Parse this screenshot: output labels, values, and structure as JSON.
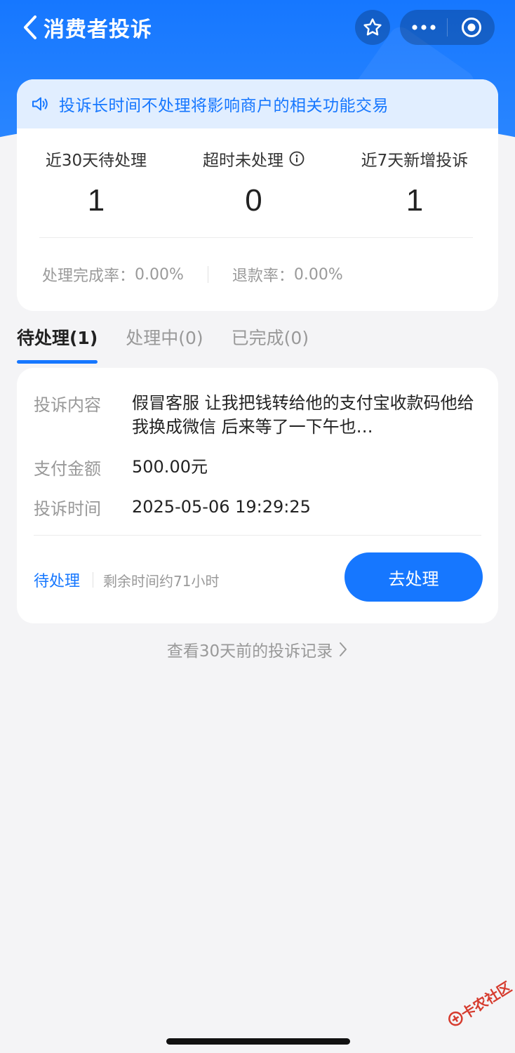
{
  "nav": {
    "title": "消费者投诉",
    "icons": {
      "back": "chevron-left-icon",
      "favorite": "star-icon",
      "more": "more-dots-icon",
      "close": "target-close-icon"
    }
  },
  "notice": {
    "icon": "speaker-icon",
    "text": "投诉长时间不处理将影响商户的相关功能交易"
  },
  "stats": [
    {
      "label": "近30天待处理",
      "value": "1"
    },
    {
      "label": "超时未处理",
      "value": "0"
    },
    {
      "label": "近7天新增投诉",
      "value": "1"
    }
  ],
  "rates": {
    "completion_label": "处理完成率：",
    "completion_value": "0.00%",
    "refund_label": "退款率：",
    "refund_value": "0.00%"
  },
  "tabs": [
    {
      "label": "待处理(1)",
      "active": true
    },
    {
      "label": "处理中(0)",
      "active": false
    },
    {
      "label": "已完成(0)",
      "active": false
    }
  ],
  "complaint": {
    "content_label": "投诉内容",
    "content_value": "假冒客服 让我把钱转给他的支付宝收款码他给我换成微信 后来等了一下午也…",
    "amount_label": "支付金额",
    "amount_value": "500.00元",
    "time_label": "投诉时间",
    "time_value": "2025-05-06 19:29:25",
    "status": "待处理",
    "remaining": "剩余时间约71小时",
    "action_label": "去处理"
  },
  "history_link": "查看30天前的投诉记录",
  "watermark": "卡农社区",
  "colors": {
    "primary": "#1677ff",
    "notice_bg": "#e1eeff",
    "page_bg": "#f4f4f6"
  }
}
